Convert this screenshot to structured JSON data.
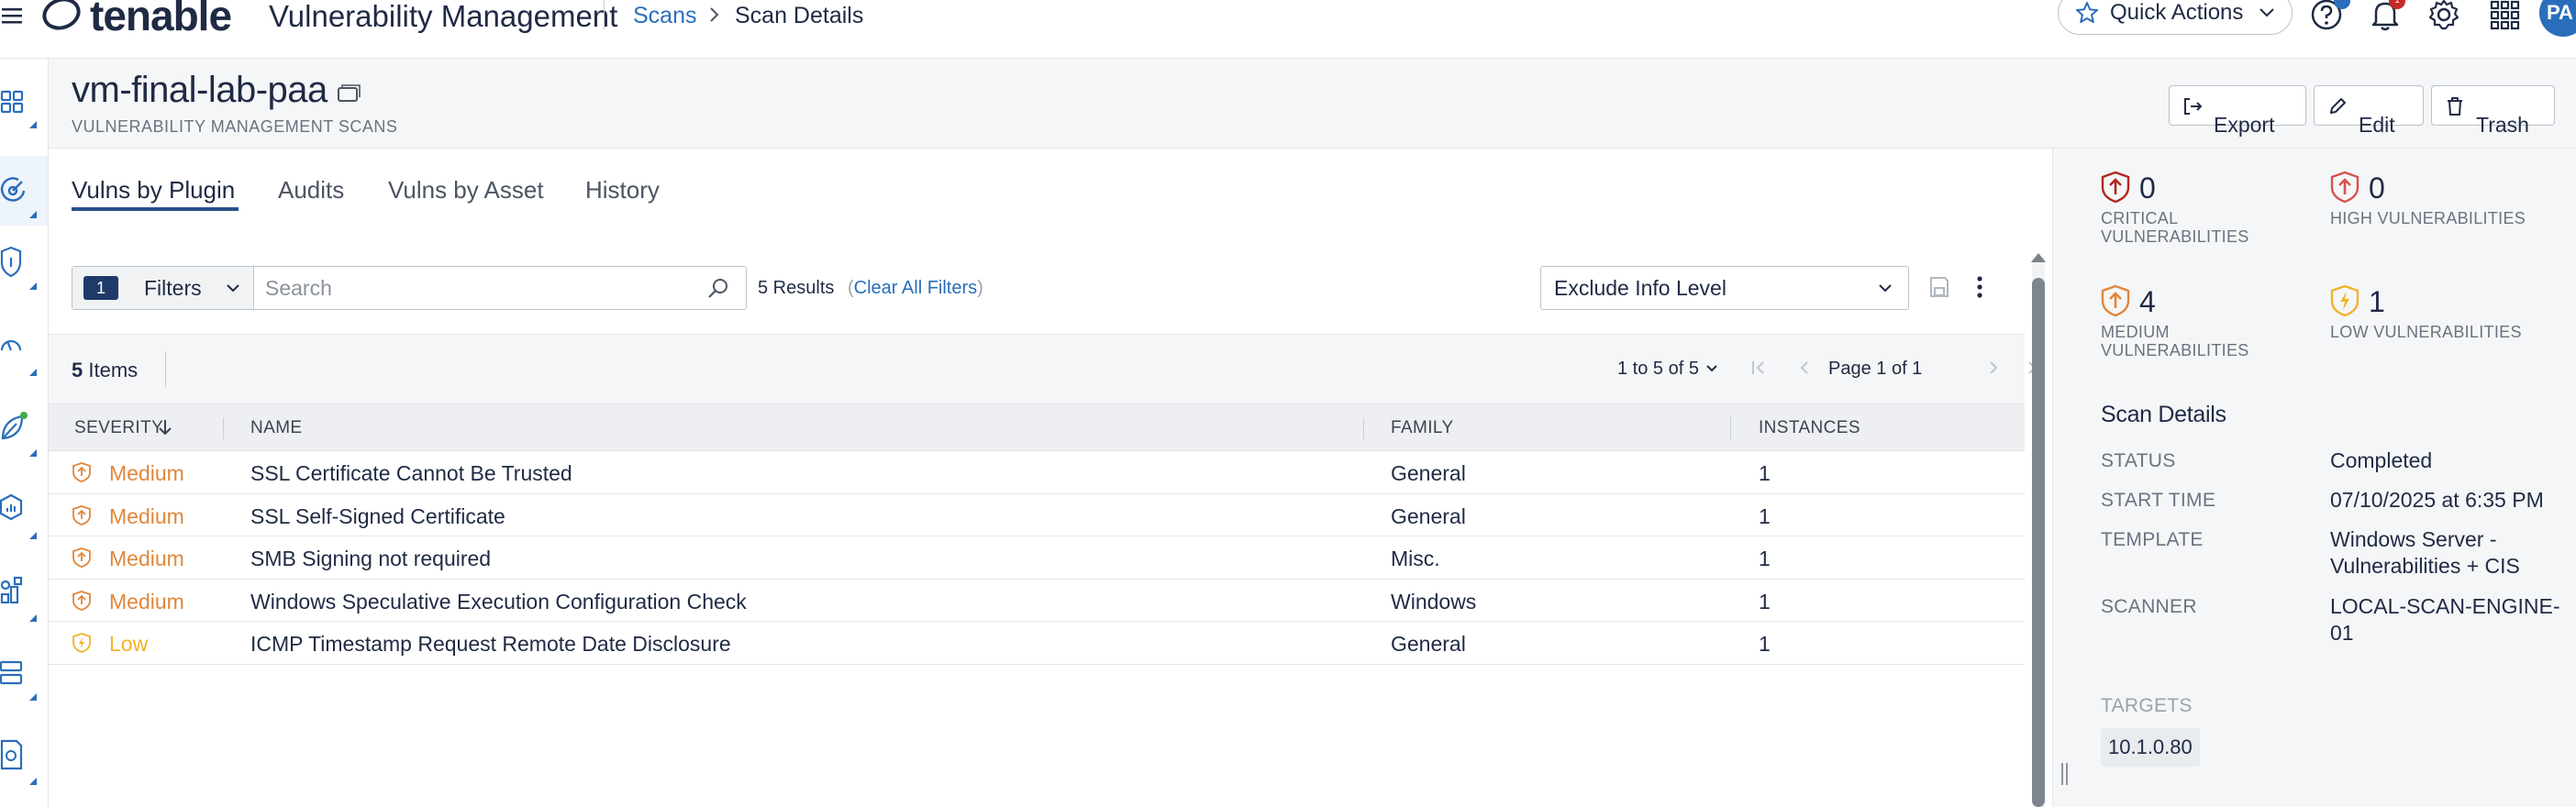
{
  "header": {
    "logo_text": "tenable",
    "product": "Vulnerability Management",
    "breadcrumb": {
      "parent": "Scans",
      "current": "Scan Details"
    },
    "quick_actions": "Quick Actions",
    "avatar_initials": "PA",
    "notification_count": "1"
  },
  "page": {
    "title": "vm-final-lab-paa",
    "subtitle": "VULNERABILITY MANAGEMENT SCANS",
    "buttons": {
      "export": "Export",
      "edit": "Edit",
      "trash": "Trash"
    }
  },
  "tabs": [
    {
      "label": "Vulns by Plugin",
      "active": true
    },
    {
      "label": "Audits"
    },
    {
      "label": "Vulns by Asset"
    },
    {
      "label": "History"
    }
  ],
  "toolbar": {
    "filter_count": "1",
    "filters_label": "Filters",
    "search_placeholder": "Search",
    "results": "5 Results",
    "clear_filters": "Clear All Filters",
    "exclude_select": "Exclude Info Level"
  },
  "table": {
    "items_count": "5",
    "items_label": "Items",
    "range": "1 to 5 of 5",
    "page_label": "Page 1 of 1",
    "columns": {
      "severity": "SEVERITY",
      "name": "NAME",
      "family": "FAMILY",
      "instances": "INSTANCES"
    },
    "rows": [
      {
        "severity": "Medium",
        "name": "SSL Certificate Cannot Be Trusted",
        "family": "General",
        "instances": "1"
      },
      {
        "severity": "Medium",
        "name": "SSL Self-Signed Certificate",
        "family": "General",
        "instances": "1"
      },
      {
        "severity": "Medium",
        "name": "SMB Signing not required",
        "family": "Misc.",
        "instances": "1"
      },
      {
        "severity": "Medium",
        "name": "Windows Speculative Execution Configuration Check",
        "family": "Windows",
        "instances": "1"
      },
      {
        "severity": "Low",
        "name": "ICMP Timestamp Request Remote Date Disclosure",
        "family": "General",
        "instances": "1"
      }
    ]
  },
  "stats": {
    "critical": {
      "count": "0",
      "label": "CRITICAL VULNERABILITIES"
    },
    "high": {
      "count": "0",
      "label": "HIGH VULNERABILITIES"
    },
    "medium": {
      "count": "4",
      "label": "MEDIUM VULNERABILITIES"
    },
    "low": {
      "count": "1",
      "label": "LOW VULNERABILITIES"
    }
  },
  "scan_details": {
    "heading": "Scan Details",
    "status_label": "STATUS",
    "status": "Completed",
    "start_label": "START TIME",
    "start_time": "07/10/2025 at 6:35 PM",
    "template_label": "TEMPLATE",
    "template": "Windows Server - Vulnerabilities + CIS",
    "scanner_label": "SCANNER",
    "scanner": "LOCAL-SCAN-ENGINE-01",
    "targets_label": "TARGETS",
    "target": "10.1.0.80"
  },
  "colors": {
    "accent": "#2a6ebb",
    "critical": "#b3261e",
    "high": "#d9534f",
    "medium": "#e0873a",
    "low": "#f0b429"
  }
}
